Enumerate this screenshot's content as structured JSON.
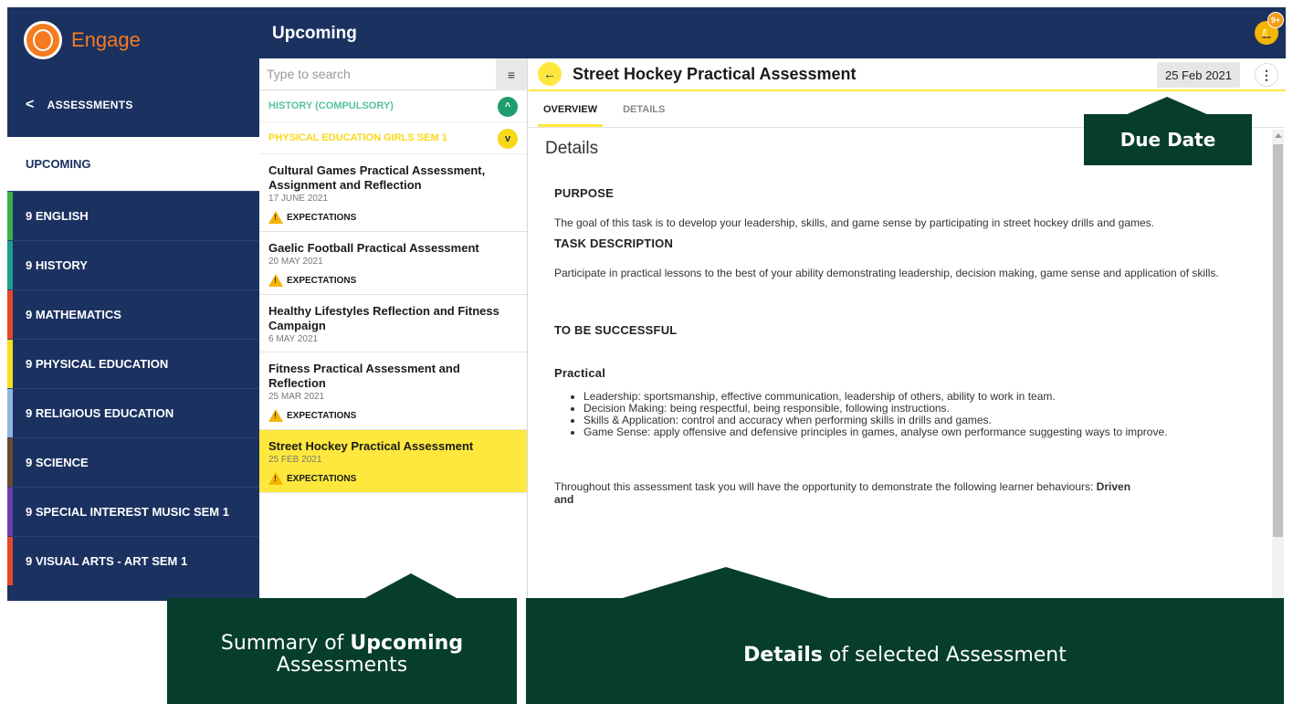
{
  "app": {
    "name": "Engage"
  },
  "sidebar": {
    "back_label": "ASSESSMENTS",
    "items": [
      {
        "label": "UPCOMING",
        "color": ""
      },
      {
        "label": "9 ENGLISH",
        "color": "#3fae49"
      },
      {
        "label": "9 HISTORY",
        "color": "#1e9e8c"
      },
      {
        "label": "9 MATHEMATICS",
        "color": "#e8462b"
      },
      {
        "label": "9 PHYSICAL EDUCATION",
        "color": "#f7e017"
      },
      {
        "label": "9 RELIGIOUS EDUCATION",
        "color": "#8fb7e0"
      },
      {
        "label": "9 SCIENCE",
        "color": "#6b4a2f"
      },
      {
        "label": "9 SPECIAL INTEREST MUSIC SEM 1",
        "color": "#6b3fb0"
      },
      {
        "label": "9 VISUAL ARTS - ART SEM 1",
        "color": "#e8462b"
      }
    ]
  },
  "header": {
    "title": "Upcoming",
    "notification_badge": "9+"
  },
  "list": {
    "search_placeholder": "Type to search",
    "groups": [
      {
        "label": "HISTORY (COMPULSORY)",
        "color": "#56c2a0",
        "button_color": "#1e9e6c",
        "icon": "chevron-up-icon",
        "glyph": "^"
      },
      {
        "label": "PHYSICAL EDUCATION GIRLS SEM 1",
        "color": "#f7d917",
        "button_color": "#f7d917",
        "icon": "chevron-down-icon",
        "glyph": "v"
      }
    ],
    "items": [
      {
        "title": "Cultural Games Practical Assessment, Assignment and Reflection",
        "date": "17 JUNE 2021",
        "tag": "EXPECTATIONS"
      },
      {
        "title": "Gaelic Football Practical Assessment",
        "date": "20 MAY 2021",
        "tag": "EXPECTATIONS"
      },
      {
        "title": "Healthy Lifestyles Reflection and Fitness Campaign",
        "date": "6 MAY 2021",
        "tag": ""
      },
      {
        "title": "Fitness Practical Assessment and Reflection",
        "date": "25 MAR 2021",
        "tag": "EXPECTATIONS"
      },
      {
        "title": "Street Hockey Practical Assessment",
        "date": "25 FEB 2021",
        "tag": "EXPECTATIONS"
      }
    ]
  },
  "detail": {
    "title": "Street Hockey Practical Assessment",
    "due_date": "25 Feb 2021",
    "tabs": [
      "OVERVIEW",
      "DETAILS"
    ],
    "section_title": "Details",
    "purpose_heading": "PURPOSE",
    "purpose_text": "The goal of this task is to develop your leadership, skills, and game sense by participating in street hockey drills and games.",
    "task_heading": "TASK DESCRIPTION",
    "task_text": "Participate in practical lessons to the best of your ability demonstrating leadership, decision making, game sense and application of skills.",
    "success_heading": "TO BE SUCCESSFUL",
    "practical_heading": "Practical",
    "bullets": [
      "Leadership: sportsmanship, effective communication, leadership of others, ability to work in team.",
      "Decision Making: being respectful, being responsible, following instructions.",
      "Skills & Application: control and accuracy when performing skills in drills and games.",
      "Game Sense: apply offensive and defensive principles in games, analyse own performance suggesting ways to improve."
    ],
    "closing_text": "Throughout this assessment task you will have the opportunity to demonstrate the following learner behaviours:",
    "closing_bold": "Driven and"
  },
  "callouts": {
    "due_date": "Due Date",
    "summary_prefix": "Summary of ",
    "summary_bold": "Upcoming",
    "summary_suffix": "Assessments",
    "details_bold": "Details",
    "details_suffix": " of selected Assessment"
  }
}
